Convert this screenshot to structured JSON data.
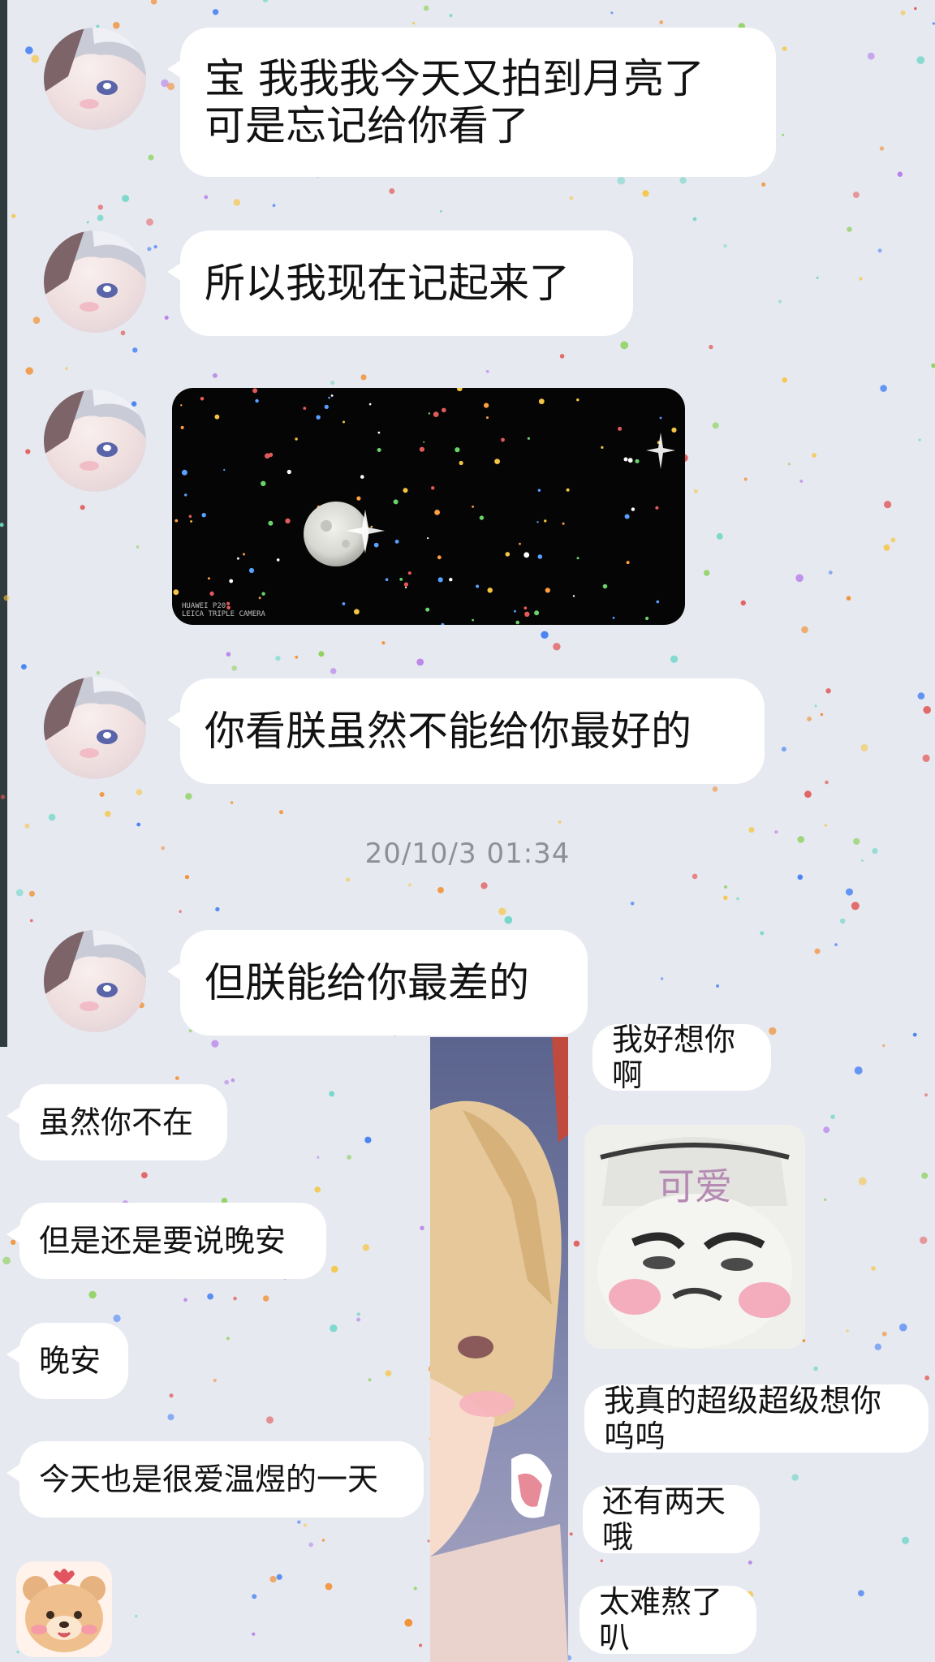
{
  "chat": {
    "friend_messages": [
      "宝 我我我今天又拍到月亮了 可是忘记给你看了",
      "所以我现在记起来了",
      "你看朕虽然不能给你最好的",
      "但朕能给你最差的"
    ],
    "timestamp": "20/10/3 01:34",
    "photo_watermark": [
      "HUAWEI P20",
      "LEICA TRIPLE CAMERA"
    ],
    "left_messages": [
      "虽然你不在",
      "但是还是要说晚安",
      "晚安",
      "今天也是很爱温煜的一天"
    ],
    "right_messages": [
      "我好想你啊",
      "我真的超级超级想你呜呜",
      "还有两天哦",
      "太难熬了叭"
    ],
    "meme_caption": "可爱"
  },
  "colors": {
    "background": "#e7e9f1",
    "bubble": "#ffffff",
    "text": "#121212",
    "timestamp": "#8f8f98"
  },
  "icons": {
    "avatar": "anime-avatar-icon",
    "moon_photo": "moon-photo-icon",
    "meme": "meme-sticker-icon",
    "bear": "bear-sticker-icon"
  }
}
